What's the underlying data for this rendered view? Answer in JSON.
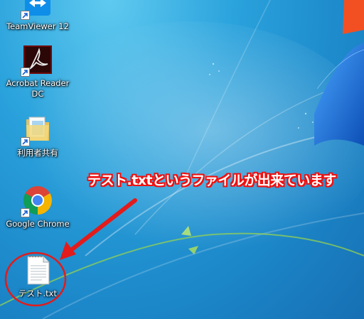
{
  "desktop": {
    "icons": [
      {
        "label": "TeamViewer 12",
        "icon": "teamviewer-icon"
      },
      {
        "label": "Acrobat Reader DC",
        "icon": "acrobat-reader-icon"
      },
      {
        "label": "利用者共有",
        "icon": "shared-folder-icon"
      },
      {
        "label": "Google Chrome",
        "icon": "chrome-icon"
      },
      {
        "label": "テスト.txt",
        "icon": "text-file-icon"
      }
    ]
  },
  "annotation": {
    "text": "テスト.txtというファイルが出来ています",
    "color": "#e31b1b"
  },
  "colors": {
    "background": "#1e8fd0",
    "windows_logo_red": "#f25022",
    "windows_logo_blue": "#1c6fd6"
  }
}
